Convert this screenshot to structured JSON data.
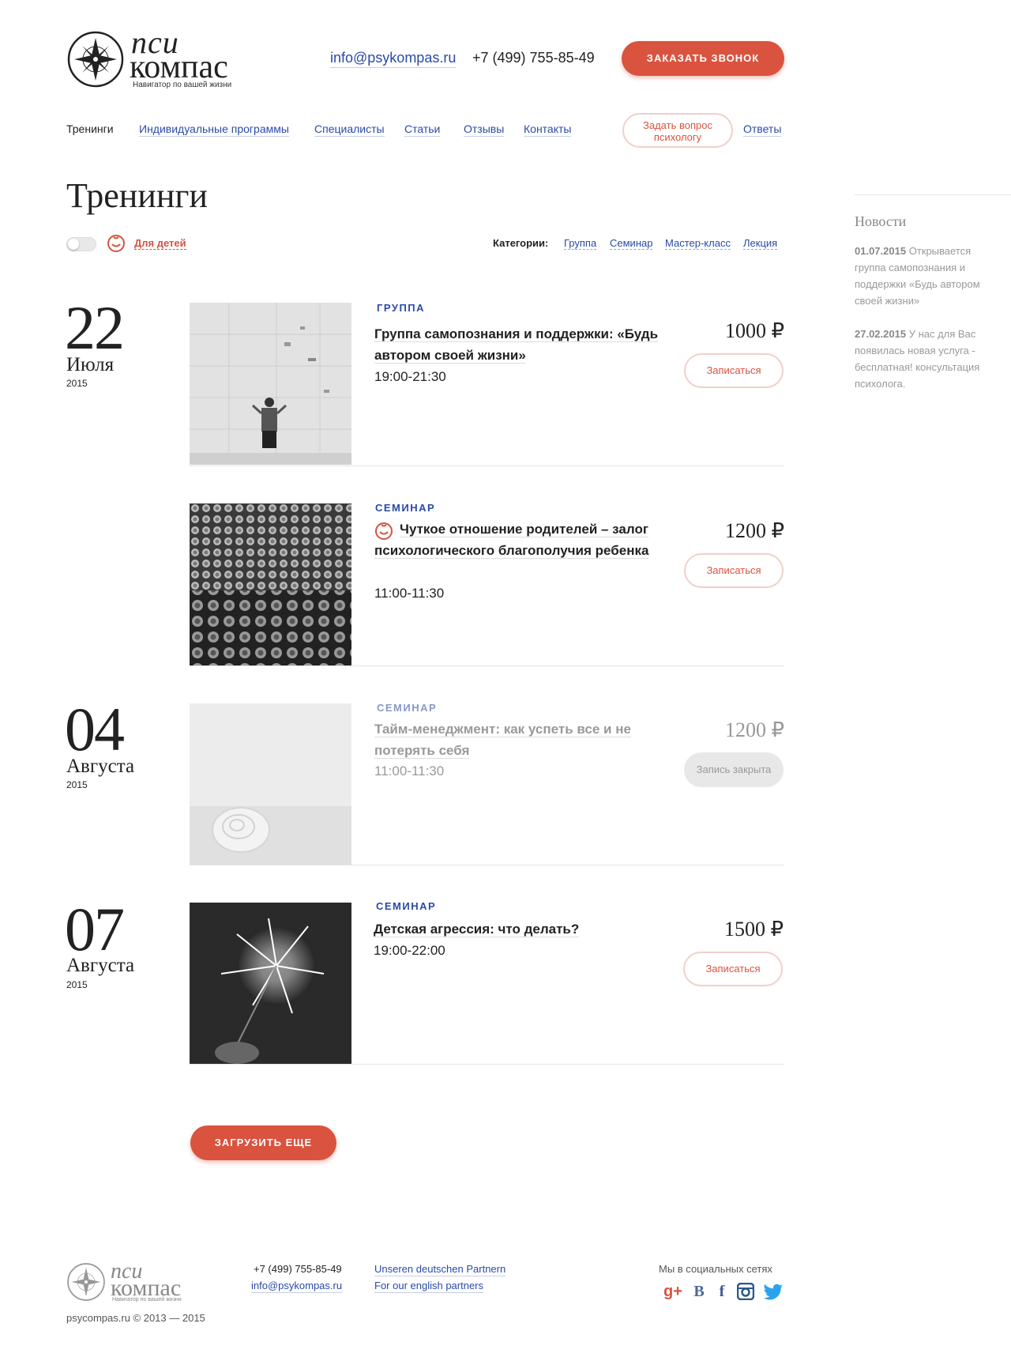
{
  "header": {
    "logo": {
      "line1": "пси",
      "line2": "компас",
      "tagline": "Навигатор по вашей жизни"
    },
    "email": "info@psykompas.ru",
    "phone": "+7 (499) 755-85-49",
    "call_button": "ЗАКАЗАТЬ ЗВОНОК"
  },
  "nav": {
    "items": [
      "Тренинги",
      "Индивидуальные программы",
      "Специалисты",
      "Статьи",
      "Отзывы",
      "Контакты"
    ],
    "ask_button": "Задать вопрос психологу",
    "answers": "Ответы"
  },
  "page": {
    "title": "Тренинги",
    "kids_label": "Для детей",
    "categories_label": "Категории:",
    "categories": [
      "Группа",
      "Семинар",
      "Мастер-класс",
      "Лекция"
    ]
  },
  "events": [
    {
      "day": "22",
      "month": "Июля",
      "year": "2015",
      "category": "ГРУППА",
      "title": "Группа самопознания и поддержки: «Будь автором своей жизни»",
      "time": "19:00-21:30",
      "price": "1000 ₽",
      "button": "Записаться",
      "kids": false,
      "closed": false
    },
    {
      "category": "СЕМИНАР",
      "title": "Чуткое отношение родителей – залог психологического благополучия ребенка",
      "time": "11:00-11:30",
      "price": "1200 ₽",
      "button": "Записаться",
      "kids": true,
      "closed": false
    },
    {
      "day": "04",
      "month": "Августа",
      "year": "2015",
      "category": "СЕМИНАР",
      "title": "Тайм-менеджмент: как успеть все и не потерять себя",
      "time": "11:00-11:30",
      "price": "1200 ₽",
      "button": "Запись закрыта",
      "kids": false,
      "closed": true
    },
    {
      "day": "07",
      "month": "Августа",
      "year": "2015",
      "category": "СЕМИНАР",
      "title": "Детская агрессия: что делать?",
      "time": "19:00-22:00",
      "price": "1500 ₽",
      "button": "Записаться",
      "kids": false,
      "closed": false
    }
  ],
  "load_more": "ЗАГРУЗИТЬ ЕЩЕ",
  "sidebar": {
    "title": "Новости",
    "news": [
      {
        "date": "01.07.2015",
        "text": "Открывается группа самопознания и поддержки «Будь автором своей жизни»"
      },
      {
        "date": "27.02.2015",
        "text": "У нас для Вас появилась новая услуга - бесплатная! консультация психолога."
      }
    ]
  },
  "footer": {
    "logo": {
      "line1": "пси",
      "line2": "компас",
      "tagline": "Навигатор по вашей жизни"
    },
    "phone": "+7 (499) 755-85-49",
    "email": "info@psykompas.ru",
    "partners_de": "Unseren deutschen Partnern",
    "partners_en": "For our english partners",
    "copyright": "psycompas.ru © 2013 — 2015",
    "social_label": "Мы в социальных сетях",
    "social": [
      {
        "name": "google-plus-icon",
        "glyph": "g+",
        "color": "#d9533f"
      },
      {
        "name": "vk-icon",
        "glyph": "B",
        "color": "#4a6a9a"
      },
      {
        "name": "facebook-icon",
        "glyph": "f",
        "color": "#3b5998"
      },
      {
        "name": "instagram-icon",
        "glyph": "◙",
        "color": "#2c5a8a"
      },
      {
        "name": "twitter-icon",
        "glyph": "🐦",
        "color": "#2aa3ef"
      }
    ]
  },
  "colors": {
    "accent": "#d9533f",
    "link": "#2a4aa8"
  }
}
